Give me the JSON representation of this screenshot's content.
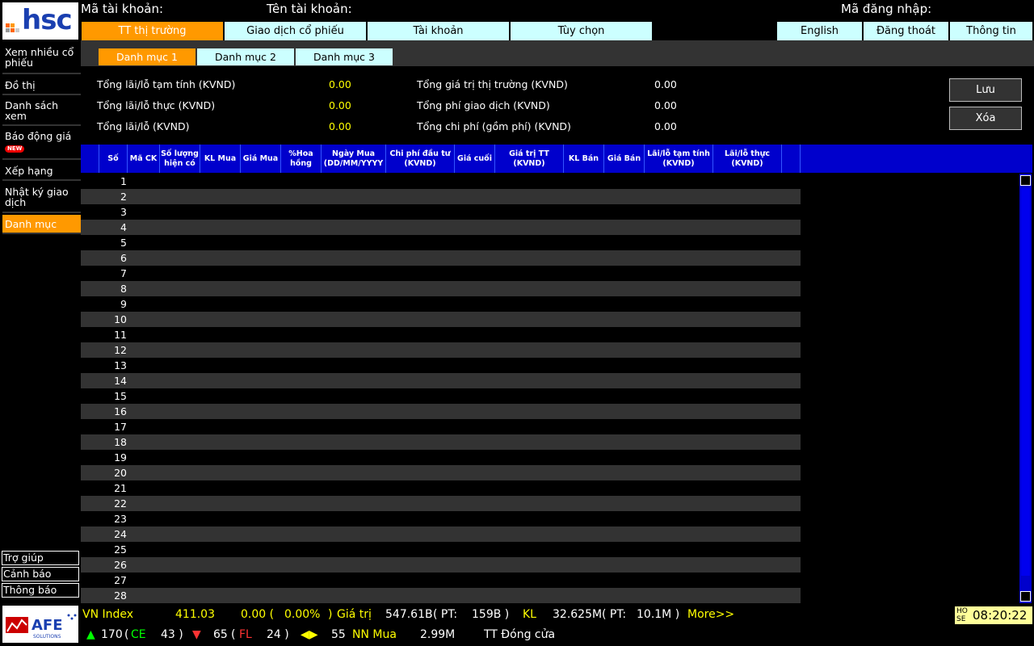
{
  "header": {
    "account_code_label": "Mã tài khoản:",
    "account_name_label": "Tên tài khoản:",
    "login_code_label": "Mã đăng nhập:",
    "logo_text": "hsc"
  },
  "top_tabs": [
    "TT thị trường",
    "Giao dịch cổ phiếu",
    "Tài khoản",
    "Tùy chọn"
  ],
  "right_tabs": [
    "English",
    "Đăng thoát",
    "Thông tin"
  ],
  "sidebar": {
    "items": [
      "Xem nhiều cổ phiếu",
      "Đồ thị",
      "Danh sách xem",
      "Báo động giá",
      "Xếp hạng",
      "Nhật ký giao dịch",
      "Danh mục"
    ],
    "new_badge": "NEW",
    "bottom": [
      "Trợ giúp",
      "Cảnh báo",
      "Thông báo"
    ]
  },
  "sub_tabs": [
    "Danh mục 1",
    "Danh mục 2",
    "Danh mục 3"
  ],
  "summary": {
    "left": [
      {
        "label": "Tổng lãi/lỗ tạm tính (KVND)",
        "value": "0.00"
      },
      {
        "label": "Tổng lãi/lỗ thực (KVND)",
        "value": "0.00"
      },
      {
        "label": "Tổng lãi/lỗ (KVND)",
        "value": "0.00"
      }
    ],
    "right": [
      {
        "label": "Tổng giá trị thị trường (KVND)",
        "value": "0.00"
      },
      {
        "label": "Tổng phí giao dịch (KVND)",
        "value": "0.00"
      },
      {
        "label": "Tổng chi phí (gồm phí) (KVND)",
        "value": "0.00"
      }
    ],
    "save_label": "Lưu",
    "delete_label": "Xóa"
  },
  "table": {
    "columns": [
      "Số",
      "Mã CK",
      "Số lượng hiện có",
      "KL Mua",
      "Giá Mua",
      "%Hoa hồng",
      "Ngày Mua (DD/MM/YYYY",
      "Chi phí đầu tư (KVND)",
      "Giá cuối",
      "Giá trị TT (KVND)",
      "KL Bán",
      "Giá Bán",
      "Lãi/lỗ tạm tính (KVND)",
      "Lãi/lỗ thực (KVND)"
    ],
    "rows": [
      "1",
      "2",
      "3",
      "4",
      "5",
      "6",
      "7",
      "8",
      "9",
      "10",
      "11",
      "12",
      "13",
      "14",
      "15",
      "16",
      "17",
      "18",
      "19",
      "20",
      "21",
      "22",
      "23",
      "24",
      "25",
      "26",
      "27",
      "28"
    ]
  },
  "footer": {
    "index_name": "VN Index",
    "index_value": "411.03",
    "change": "0.00 (",
    "change_pct": "0.00%",
    "close_paren": ")",
    "value_label": "Giá trị",
    "value": "547.61B",
    "pt_label": "( PT:",
    "pt_value": "159B )",
    "kl_label": "KL",
    "kl_value": "32.625M",
    "kl_pt_label": "( PT:",
    "kl_pt_value": "10.1M )",
    "more": "More>>",
    "up_count": "170",
    "ce_label": "CE",
    "ce_count": "43 )",
    "down_count": "65",
    "fl_label": "FL",
    "fl_count": "24 )",
    "unchanged_count": "55",
    "nn_label": "NN Mua",
    "nn_value": "2.99M",
    "market_status": "TT Đóng cửa",
    "exchange": "HO SE",
    "time": "08:20:22",
    "afe_logo": "AFE SOLUTIONS"
  }
}
